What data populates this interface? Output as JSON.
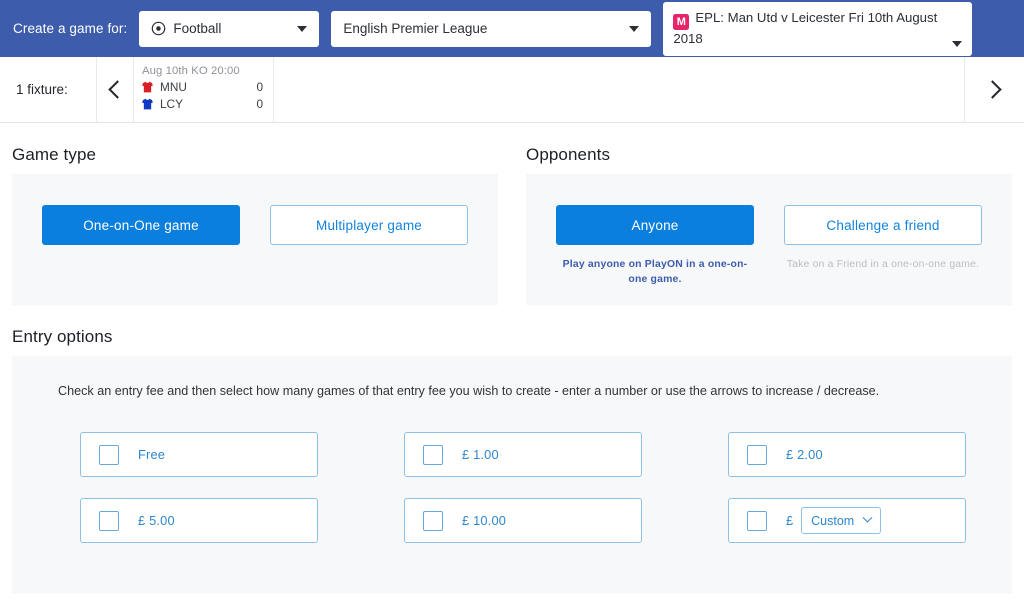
{
  "header": {
    "label": "Create a game for:",
    "sport_select": {
      "value": "Football",
      "icon": "football-icon"
    },
    "league_select": {
      "value": "English Premier League"
    },
    "fixture_select": {
      "badge": "M",
      "value": "EPL: Man Utd v Leicester Fri 10th August 2018"
    }
  },
  "fixture_bar": {
    "count_label": "1 fixture:",
    "prev_icon": "chevron-left-icon",
    "next_icon": "chevron-right-icon",
    "card": {
      "date": "Aug 10th KO 20:00",
      "rows": [
        {
          "team": "MNU",
          "score": "0",
          "color": "#d81f26"
        },
        {
          "team": "LCY",
          "score": "0",
          "color": "#1138c4"
        }
      ]
    }
  },
  "game_type": {
    "title": "Game type",
    "options": [
      {
        "label": "One-on-One game",
        "selected": true
      },
      {
        "label": "Multiplayer game",
        "selected": false
      }
    ]
  },
  "opponents": {
    "title": "Opponents",
    "options": [
      {
        "label": "Anyone",
        "selected": true,
        "caption": "Play anyone on PlayON in a one-on-one game."
      },
      {
        "label": "Challenge a friend",
        "selected": false,
        "caption": "Take on a Friend in a one-on-one game."
      }
    ]
  },
  "entry_options": {
    "title": "Entry options",
    "hint": "Check an entry fee and then select how many games of that entry fee you wish to create - enter a number or use the arrows to increase / decrease.",
    "fees": [
      {
        "label": "Free",
        "checked": false,
        "type": "plain"
      },
      {
        "label": "£ 1.00",
        "checked": false,
        "type": "plain"
      },
      {
        "label": "£ 2.00",
        "checked": false,
        "type": "plain"
      },
      {
        "label": "£ 5.00",
        "checked": false,
        "type": "plain"
      },
      {
        "label": "£ 10.00",
        "checked": false,
        "type": "plain"
      },
      {
        "currency": "£",
        "custom_value": "Custom",
        "checked": false,
        "type": "custom"
      }
    ]
  },
  "colors": {
    "header_blue": "#3d5cab",
    "accent_blue": "#0b7fdd",
    "badge_pink": "#e8256b",
    "panel_bg": "#f7f8f9",
    "border_blue": "#8fc0e6"
  }
}
